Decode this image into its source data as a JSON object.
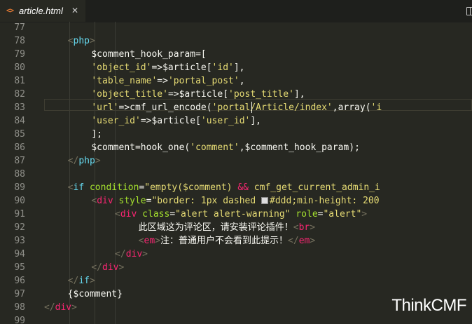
{
  "tab": {
    "label": "article.html",
    "icon": "code-file-icon",
    "close": "✕"
  },
  "lines": [
    {
      "n": "77",
      "tokens": []
    },
    {
      "n": "78",
      "tokens": [
        {
          "c": "t-bracket",
          "t": "<"
        },
        {
          "c": "t-php",
          "t": "php"
        },
        {
          "c": "t-bracket",
          "t": ">"
        }
      ],
      "indent": 16
    },
    {
      "n": "79",
      "tokens": [
        {
          "c": "t-var",
          "t": "$comment_hook_param=["
        }
      ],
      "indent": 20
    },
    {
      "n": "80",
      "tokens": [
        {
          "c": "t-str",
          "t": "'object_id'"
        },
        {
          "c": "t-var",
          "t": "=>$article["
        },
        {
          "c": "t-str",
          "t": "'id'"
        },
        {
          "c": "t-var",
          "t": "],"
        }
      ],
      "indent": 20
    },
    {
      "n": "81",
      "tokens": [
        {
          "c": "t-str",
          "t": "'table_name'"
        },
        {
          "c": "t-var",
          "t": "=>"
        },
        {
          "c": "t-str",
          "t": "'portal_post'"
        },
        {
          "c": "t-var",
          "t": ","
        }
      ],
      "indent": 20
    },
    {
      "n": "82",
      "tokens": [
        {
          "c": "t-str",
          "t": "'object_title'"
        },
        {
          "c": "t-var",
          "t": "=>$article["
        },
        {
          "c": "t-str",
          "t": "'post_title'"
        },
        {
          "c": "t-var",
          "t": "],"
        }
      ],
      "indent": 20
    },
    {
      "n": "83",
      "tokens": [
        {
          "c": "t-str",
          "t": "'url'"
        },
        {
          "c": "t-var",
          "t": "=>cmf_url_encode("
        },
        {
          "c": "t-str",
          "t": "'portal/Article/index'"
        },
        {
          "c": "t-var",
          "t": ",array("
        },
        {
          "c": "t-str",
          "t": "'i"
        }
      ],
      "indent": 20
    },
    {
      "n": "84",
      "tokens": [
        {
          "c": "t-str",
          "t": "'user_id'"
        },
        {
          "c": "t-var",
          "t": "=>$article["
        },
        {
          "c": "t-str",
          "t": "'user_id'"
        },
        {
          "c": "t-var",
          "t": "],"
        }
      ],
      "indent": 20
    },
    {
      "n": "85",
      "tokens": [
        {
          "c": "t-var",
          "t": "];"
        }
      ],
      "indent": 20
    },
    {
      "n": "86",
      "tokens": [
        {
          "c": "t-var",
          "t": "$comment=hook_one("
        },
        {
          "c": "t-str",
          "t": "'comment'"
        },
        {
          "c": "t-var",
          "t": ",$comment_hook_param);"
        }
      ],
      "indent": 20
    },
    {
      "n": "87",
      "tokens": [
        {
          "c": "t-bracket",
          "t": "</"
        },
        {
          "c": "t-php",
          "t": "php"
        },
        {
          "c": "t-bracket",
          "t": ">"
        }
      ],
      "indent": 16
    },
    {
      "n": "88",
      "tokens": []
    },
    {
      "n": "89",
      "tokens": [
        {
          "c": "t-bracket",
          "t": "<"
        },
        {
          "c": "t-php",
          "t": "if"
        },
        {
          "c": "t-punc",
          "t": " "
        },
        {
          "c": "t-attr",
          "t": "condition"
        },
        {
          "c": "t-punc",
          "t": "="
        },
        {
          "c": "t-str",
          "t": "\"empty($comment) "
        },
        {
          "c": "t-kw",
          "t": "&&"
        },
        {
          "c": "t-str",
          "t": " cmf_get_current_admin_i"
        }
      ],
      "indent": 16
    },
    {
      "n": "90",
      "tokens": [
        {
          "c": "t-bracket",
          "t": "<"
        },
        {
          "c": "t-tag",
          "t": "div"
        },
        {
          "c": "t-punc",
          "t": " "
        },
        {
          "c": "t-attr",
          "t": "style"
        },
        {
          "c": "t-punc",
          "t": "="
        },
        {
          "c": "t-str",
          "t": "\"border: 1px dashed "
        },
        {
          "c": "swatch",
          "t": ""
        },
        {
          "c": "t-str",
          "t": "#ddd;min-height: 200"
        }
      ],
      "indent": 20
    },
    {
      "n": "91",
      "tokens": [
        {
          "c": "t-bracket",
          "t": "<"
        },
        {
          "c": "t-tag",
          "t": "div"
        },
        {
          "c": "t-punc",
          "t": " "
        },
        {
          "c": "t-attr",
          "t": "class"
        },
        {
          "c": "t-punc",
          "t": "="
        },
        {
          "c": "t-str",
          "t": "\"alert alert-warning\""
        },
        {
          "c": "t-punc",
          "t": " "
        },
        {
          "c": "t-attr",
          "t": "role"
        },
        {
          "c": "t-punc",
          "t": "="
        },
        {
          "c": "t-str",
          "t": "\"alert\""
        },
        {
          "c": "t-bracket",
          "t": ">"
        }
      ],
      "indent": 24
    },
    {
      "n": "92",
      "tokens": [
        {
          "c": "t-var",
          "t": "此区域这为评论区，请安装评论插件！"
        },
        {
          "c": "t-bracket",
          "t": "<"
        },
        {
          "c": "t-tag",
          "t": "br"
        },
        {
          "c": "t-bracket",
          "t": ">"
        }
      ],
      "indent": 28
    },
    {
      "n": "93",
      "tokens": [
        {
          "c": "t-bracket",
          "t": "<"
        },
        {
          "c": "t-tag",
          "t": "em"
        },
        {
          "c": "t-bracket",
          "t": ">"
        },
        {
          "c": "t-var",
          "t": "注：普通用户不会看到此提示！"
        },
        {
          "c": "t-bracket",
          "t": "</"
        },
        {
          "c": "t-tag",
          "t": "em"
        },
        {
          "c": "t-bracket",
          "t": ">"
        }
      ],
      "indent": 28
    },
    {
      "n": "94",
      "tokens": [
        {
          "c": "t-bracket",
          "t": "</"
        },
        {
          "c": "t-tag",
          "t": "div"
        },
        {
          "c": "t-bracket",
          "t": ">"
        }
      ],
      "indent": 24
    },
    {
      "n": "95",
      "tokens": [
        {
          "c": "t-bracket",
          "t": "</"
        },
        {
          "c": "t-tag",
          "t": "div"
        },
        {
          "c": "t-bracket",
          "t": ">"
        }
      ],
      "indent": 20
    },
    {
      "n": "96",
      "tokens": [
        {
          "c": "t-bracket",
          "t": "</"
        },
        {
          "c": "t-php",
          "t": "if"
        },
        {
          "c": "t-bracket",
          "t": ">"
        }
      ],
      "indent": 16
    },
    {
      "n": "97",
      "tokens": [
        {
          "c": "t-var",
          "t": "{$comment}"
        }
      ],
      "indent": 16
    },
    {
      "n": "98",
      "tokens": [
        {
          "c": "t-bracket",
          "t": "</"
        },
        {
          "c": "t-tag",
          "t": "div"
        },
        {
          "c": "t-bracket",
          "t": ">"
        }
      ],
      "indent": 12
    },
    {
      "n": "99",
      "tokens": []
    }
  ],
  "watermark": "ThinkCMF",
  "colors": {
    "background": "#272822",
    "tag": "#f92672",
    "attribute": "#a6e22e",
    "string": "#e6db74",
    "keyword": "#66d9ef"
  }
}
